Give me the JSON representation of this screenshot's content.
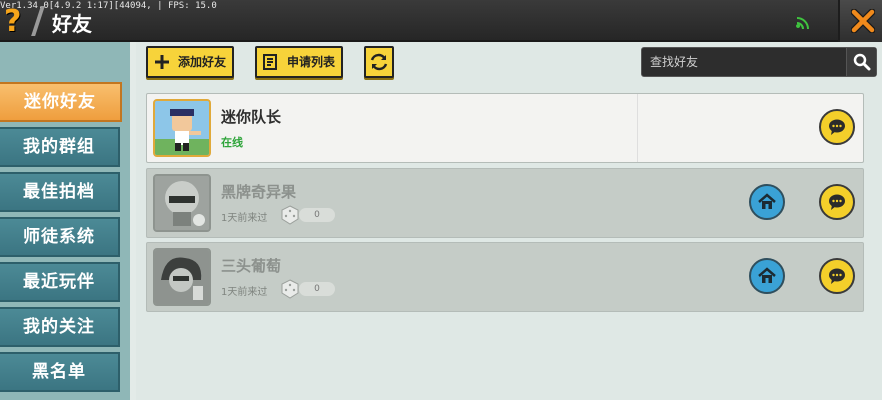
{
  "topbar": {
    "debug_text": "Ver1.34.0[4.9.2 1:17][44094, | FPS: 15.0",
    "help_label": "?",
    "title": "好友"
  },
  "sidebar": {
    "items": [
      {
        "label": "迷你好友",
        "active": true
      },
      {
        "label": "我的群组",
        "active": false
      },
      {
        "label": "最佳拍档",
        "active": false
      },
      {
        "label": "师徒系统",
        "active": false
      },
      {
        "label": "最近玩伴",
        "active": false
      },
      {
        "label": "我的关注",
        "active": false
      },
      {
        "label": "黑名单",
        "active": false
      }
    ]
  },
  "toolbar": {
    "add_friend_label": "添加好友",
    "request_list_label": "申请列表",
    "search_placeholder": "查找好友"
  },
  "friends": [
    {
      "name": "迷你队长",
      "status": "在线",
      "online": true
    },
    {
      "name": "黑牌奇异果",
      "last_seen": "1天前来过",
      "count": "0",
      "online": false
    },
    {
      "name": "三头葡萄",
      "last_seen": "1天前来过",
      "count": "0",
      "online": false
    }
  ],
  "colors": {
    "accent_yellow": "#f7d33a",
    "active_tab": "#f2a64a",
    "tab": "#457f8c",
    "online_green": "#2ea43a",
    "close_orange": "#f08a1c"
  }
}
